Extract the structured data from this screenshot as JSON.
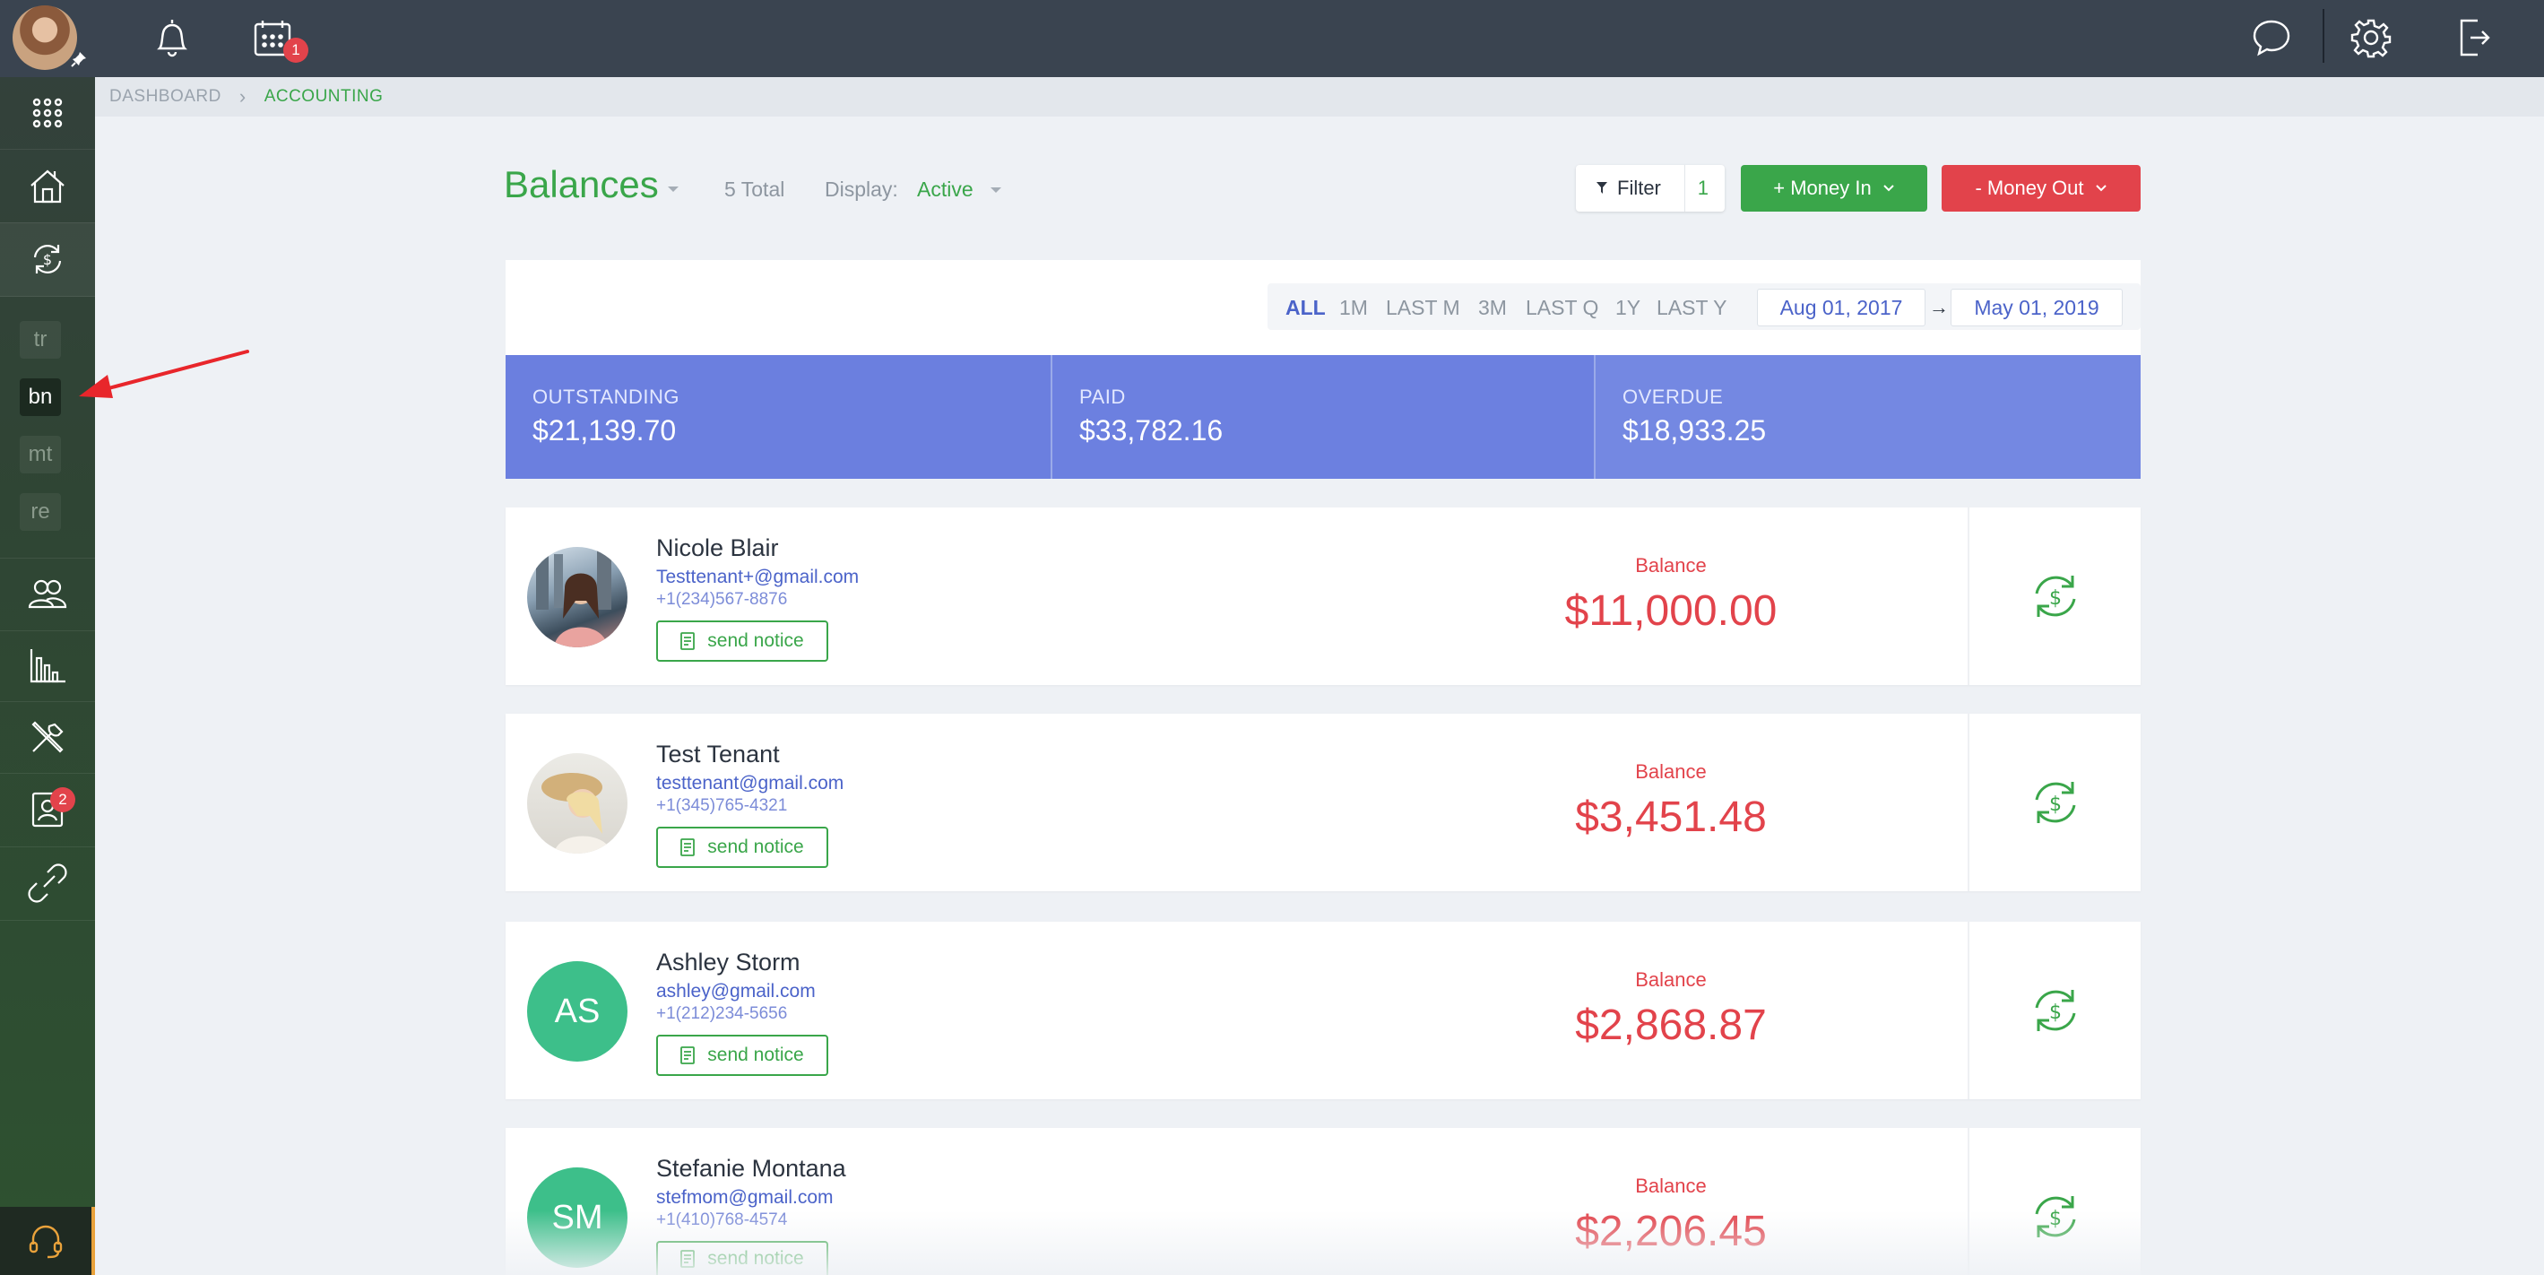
{
  "breadcrumb": {
    "root": "DASHBOARD",
    "current": "ACCOUNTING"
  },
  "topbar": {
    "calendar_badge": "1"
  },
  "sidebar": {
    "sub_items": [
      "tr",
      "bn",
      "mt",
      "re"
    ],
    "current_sub": "bn",
    "contacts_badge": "2"
  },
  "header": {
    "title": "Balances",
    "total": "5 Total",
    "display_label": "Display:",
    "display_value": "Active",
    "filter_label": "Filter",
    "filter_count": "1",
    "money_in": "+ Money In",
    "money_out": "- Money Out"
  },
  "periods": [
    "ALL",
    "1M",
    "LAST M",
    "3M",
    "LAST Q",
    "1Y",
    "LAST Y"
  ],
  "active_period": "ALL",
  "dates": {
    "from": "Aug 01, 2017",
    "to": "May 01, 2019"
  },
  "stats": [
    {
      "label": "OUTSTANDING",
      "value": "$21,139.70"
    },
    {
      "label": "PAID",
      "value": "$33,782.16"
    },
    {
      "label": "OVERDUE",
      "value": "$18,933.25"
    }
  ],
  "notice_label": "send notice",
  "balance_label": "Balance",
  "tenants": [
    {
      "name": "Nicole Blair",
      "email": "Testtenant+@gmail.com",
      "phone": "+1(234)567-8876",
      "balance": "$11,000.00",
      "initials": ""
    },
    {
      "name": "Test Tenant",
      "email": "testtenant@gmail.com",
      "phone": "+1(345)765-4321",
      "balance": "$3,451.48",
      "initials": ""
    },
    {
      "name": "Ashley Storm",
      "email": "ashley@gmail.com",
      "phone": "+1(212)234-5656",
      "balance": "$2,868.87",
      "initials": "AS"
    },
    {
      "name": "Stefanie Montana",
      "email": "stefmom@gmail.com",
      "phone": "+1(410)768-4574",
      "balance": "$2,206.45",
      "initials": "SM"
    }
  ],
  "colors": {
    "accent_green": "#3aa64a",
    "danger_red": "#e2434b",
    "stats_blue": "#6b7fdf",
    "link_blue": "#4b63c9"
  }
}
